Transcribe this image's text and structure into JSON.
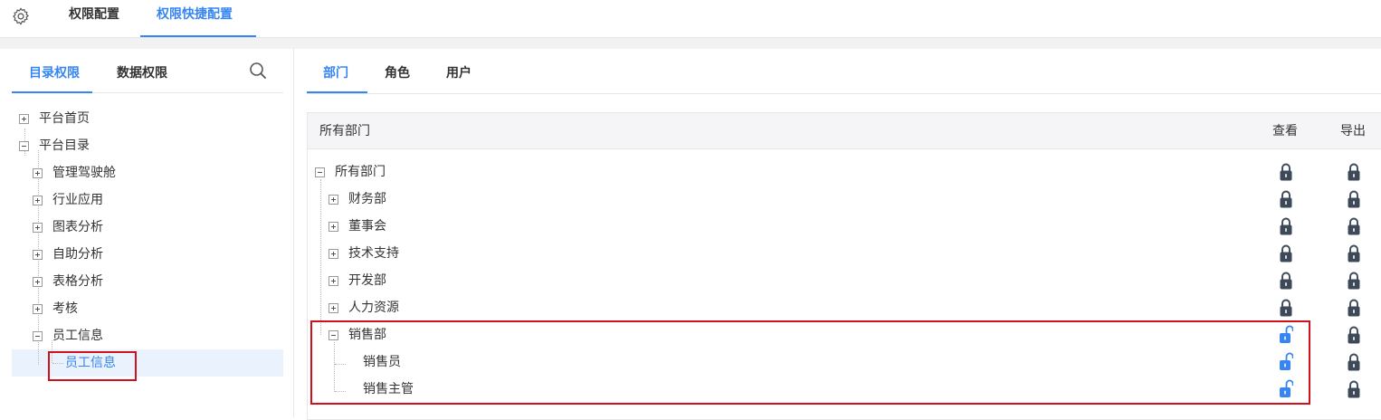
{
  "top_tabs": [
    {
      "label": "权限配置",
      "active": false
    },
    {
      "label": "权限快捷配置",
      "active": true
    }
  ],
  "left": {
    "tabs": [
      {
        "label": "目录权限",
        "active": true
      },
      {
        "label": "数据权限",
        "active": false
      }
    ],
    "tree": [
      {
        "label": "平台首页",
        "level": 0,
        "state": "collapsed"
      },
      {
        "label": "平台目录",
        "level": 0,
        "state": "expanded"
      },
      {
        "label": "管理驾驶舱",
        "level": 1,
        "state": "collapsed"
      },
      {
        "label": "行业应用",
        "level": 1,
        "state": "collapsed"
      },
      {
        "label": "图表分析",
        "level": 1,
        "state": "collapsed"
      },
      {
        "label": "自助分析",
        "level": 1,
        "state": "collapsed"
      },
      {
        "label": "表格分析",
        "level": 1,
        "state": "collapsed"
      },
      {
        "label": "考核",
        "level": 1,
        "state": "collapsed"
      },
      {
        "label": "员工信息",
        "level": 1,
        "state": "expanded"
      },
      {
        "label": "员工信息",
        "level": 2,
        "state": "leaf",
        "selected": true
      }
    ]
  },
  "right": {
    "tabs": [
      {
        "label": "部门",
        "active": true
      },
      {
        "label": "角色",
        "active": false
      },
      {
        "label": "用户",
        "active": false
      }
    ],
    "columns": {
      "name": "所有部门",
      "view": "查看",
      "export": "导出"
    },
    "rows": [
      {
        "label": "所有部门",
        "level": 0,
        "state": "expanded",
        "view": "locked",
        "export": "locked"
      },
      {
        "label": "财务部",
        "level": 1,
        "state": "collapsed",
        "view": "locked",
        "export": "locked"
      },
      {
        "label": "董事会",
        "level": 1,
        "state": "collapsed",
        "view": "locked",
        "export": "locked"
      },
      {
        "label": "技术支持",
        "level": 1,
        "state": "collapsed",
        "view": "locked",
        "export": "locked"
      },
      {
        "label": "开发部",
        "level": 1,
        "state": "collapsed",
        "view": "locked",
        "export": "locked"
      },
      {
        "label": "人力资源",
        "level": 1,
        "state": "collapsed",
        "view": "locked",
        "export": "locked"
      },
      {
        "label": "销售部",
        "level": 1,
        "state": "expanded",
        "view": "unlocked",
        "export": "locked"
      },
      {
        "label": "销售员",
        "level": 2,
        "state": "leaf",
        "view": "unlocked",
        "export": "locked"
      },
      {
        "label": "销售主管",
        "level": 2,
        "state": "leaf",
        "view": "unlocked",
        "export": "locked"
      }
    ]
  },
  "colors": {
    "accent": "#3685f2",
    "lock_dark": "#3d4858",
    "lock_open": "#3685f2",
    "highlight_border": "#d0101b"
  },
  "icons": {
    "settings": "gear-icon",
    "search": "search-icon",
    "locked": "lock-icon",
    "unlocked": "unlock-icon"
  }
}
